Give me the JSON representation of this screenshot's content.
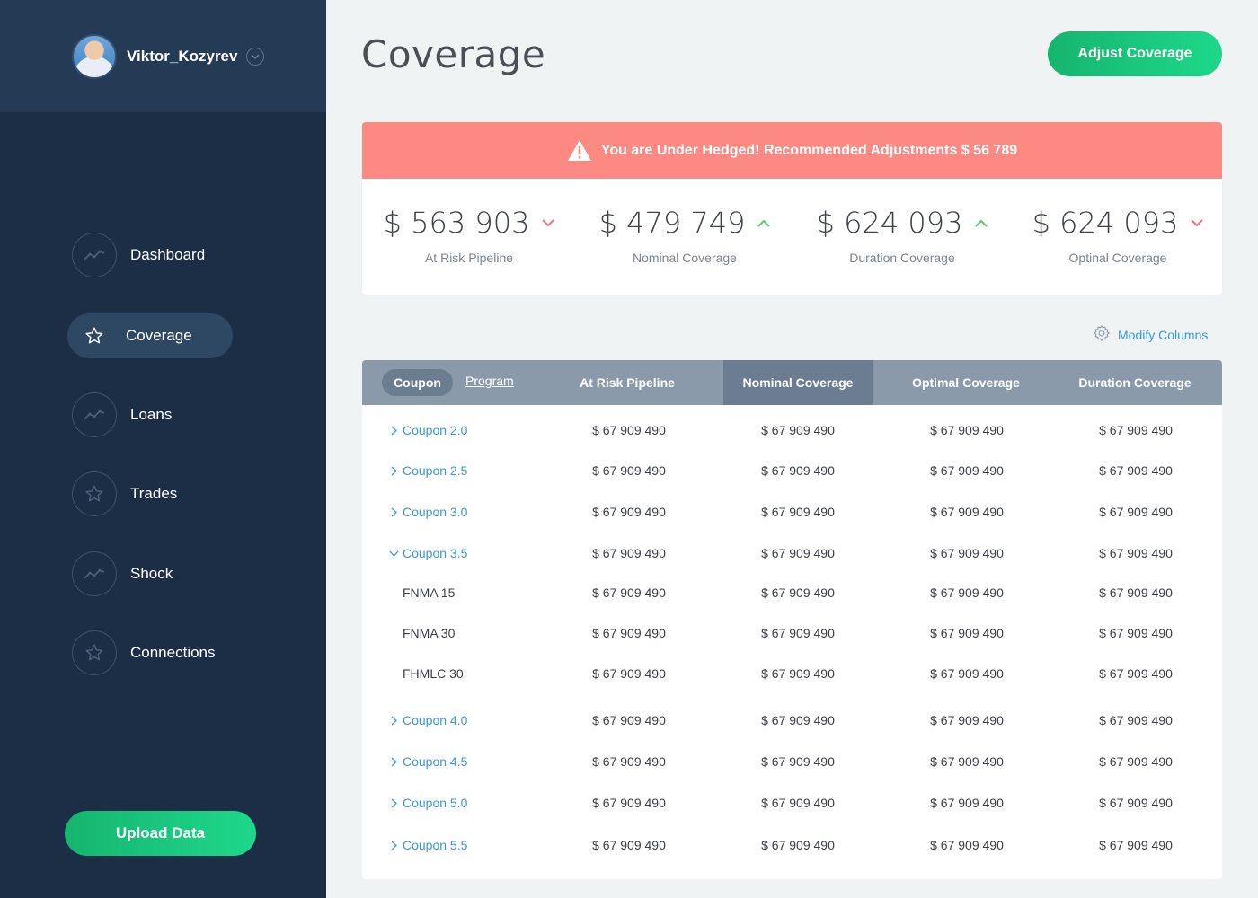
{
  "sidebar": {
    "username": "Viktor_Kozyrev",
    "nav": [
      {
        "label": "Dashboard",
        "icon": "trend-line-icon",
        "active": false
      },
      {
        "label": "Coverage",
        "icon": "star-icon",
        "active": true
      },
      {
        "label": "Loans",
        "icon": "trend-line-icon",
        "active": false
      },
      {
        "label": "Trades",
        "icon": "star-icon",
        "active": false
      },
      {
        "label": "Shock",
        "icon": "trend-line-icon",
        "active": false
      },
      {
        "label": "Connections",
        "icon": "star-icon",
        "active": false
      }
    ],
    "upload_label": "Upload Data"
  },
  "header": {
    "title": "Coverage",
    "adjust_label": "Adjust Coverage"
  },
  "alert": {
    "text": "You are Under Hedged! Recommended Adjustments $ 56 789",
    "color": "#fd8a82"
  },
  "stats": [
    {
      "value": "$ 563 903",
      "label": "At Risk Pipeline",
      "trend": "down"
    },
    {
      "value": "$ 479 749",
      "label": "Nominal Coverage",
      "trend": "up"
    },
    {
      "value": "$ 624 093",
      "label": "Duration Coverage",
      "trend": "up"
    },
    {
      "value": "$ 624 093",
      "label": "Optinal Coverage",
      "trend": "down"
    }
  ],
  "modify_columns_label": "Modify Columns",
  "table": {
    "tabs": {
      "coupon": "Coupon",
      "program": "Program"
    },
    "columns": [
      "At Risk Pipeline",
      "Nominal Coverage",
      "Optimal Coverage",
      "Duration Coverage"
    ],
    "rows": [
      {
        "name": "Coupon 2.0",
        "type": "group",
        "expanded": false,
        "values": [
          "$ 67 909 490",
          "$ 67 909 490",
          "$ 67 909 490",
          "$ 67 909 490"
        ]
      },
      {
        "name": "Coupon 2.5",
        "type": "group",
        "expanded": false,
        "values": [
          "$ 67 909 490",
          "$ 67 909 490",
          "$ 67 909 490",
          "$ 67 909 490"
        ]
      },
      {
        "name": "Coupon 3.0",
        "type": "group",
        "expanded": false,
        "values": [
          "$ 67 909 490",
          "$ 67 909 490",
          "$ 67 909 490",
          "$ 67 909 490"
        ]
      },
      {
        "name": "Coupon 3.5",
        "type": "group",
        "expanded": true,
        "values": [
          "$ 67 909 490",
          "$ 67 909 490",
          "$ 67 909 490",
          "$ 67 909 490"
        ]
      },
      {
        "name": "FNMA 15",
        "type": "child",
        "values": [
          "$ 67 909 490",
          "$ 67 909 490",
          "$ 67 909 490",
          "$ 67 909 490"
        ]
      },
      {
        "name": "FNMA 30",
        "type": "child",
        "values": [
          "$ 67 909 490",
          "$ 67 909 490",
          "$ 67 909 490",
          "$ 67 909 490"
        ]
      },
      {
        "name": "FHMLC 30",
        "type": "child",
        "values": [
          "$ 67 909 490",
          "$ 67 909 490",
          "$ 67 909 490",
          "$ 67 909 490"
        ]
      },
      {
        "name": "Coupon 4.0",
        "type": "group",
        "expanded": false,
        "values": [
          "$ 67 909 490",
          "$ 67 909 490",
          "$ 67 909 490",
          "$ 67 909 490"
        ]
      },
      {
        "name": "Coupon 4.5",
        "type": "group",
        "expanded": false,
        "values": [
          "$ 67 909 490",
          "$ 67 909 490",
          "$ 67 909 490",
          "$ 67 909 490"
        ]
      },
      {
        "name": "Coupon 5.0",
        "type": "group",
        "expanded": false,
        "values": [
          "$ 67 909 490",
          "$ 67 909 490",
          "$ 67 909 490",
          "$ 67 909 490"
        ]
      },
      {
        "name": "Coupon 5.5",
        "type": "group",
        "expanded": false,
        "values": [
          "$ 67 909 490",
          "$ 67 909 490",
          "$ 67 909 490",
          "$ 67 909 490"
        ]
      }
    ]
  },
  "colors": {
    "sidebar_bg": "#1c2e45",
    "accent_green": "#1dd88a",
    "link_blue": "#3a98d6",
    "trend_up": "#5cc96e",
    "trend_down": "#f0707a"
  }
}
